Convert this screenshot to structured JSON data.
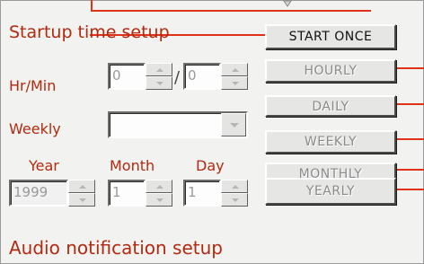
{
  "startup": {
    "title": "Startup time setup",
    "hrmin_label": "Hr/Min",
    "hour_value": "0",
    "minute_value": "0",
    "separator": "/",
    "weekly_label": "Weekly",
    "weekly_value": "",
    "year_label": "Year",
    "month_label": "Month",
    "day_label": "Day",
    "year_value": "1999",
    "month_value": "1",
    "day_value": "1"
  },
  "buttons": {
    "start_once": "START ONCE",
    "hourly": "HOURLY",
    "daily": "DAILY",
    "weekly": "WEEKLY",
    "monthly": "MONTHLY",
    "yearly": "YEARLY"
  },
  "audio": {
    "title": "Audio notification setup"
  },
  "colors": {
    "label_red": "#b2290f",
    "line_red": "#e0311a"
  }
}
